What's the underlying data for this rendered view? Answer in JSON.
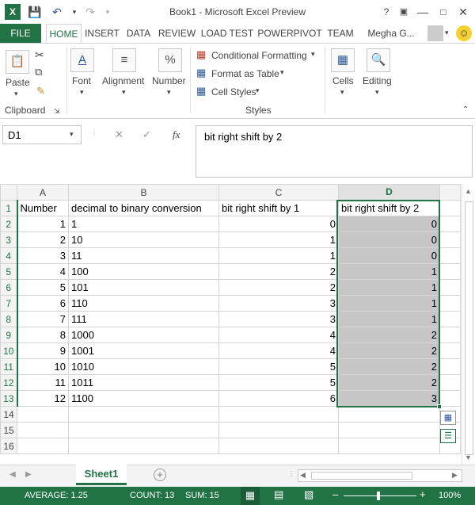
{
  "window": {
    "title": "Book1 - Microsoft Excel Preview"
  },
  "tabs": [
    "FILE",
    "HOME",
    "INSERT",
    "DATA",
    "REVIEW",
    "LOAD TEST",
    "POWERPIVOT",
    "TEAM"
  ],
  "user": "Megha G...",
  "ribbon": {
    "paste": "Paste",
    "clipboard": "Clipboard",
    "font": "Font",
    "alignment": "Alignment",
    "number": "Number",
    "conditional_formatting": "Conditional Formatting",
    "format_as_table": "Format as Table",
    "cell_styles": "Cell Styles",
    "styles": "Styles",
    "cells": "Cells",
    "editing": "Editing"
  },
  "formula_bar": {
    "name_box": "D1",
    "fx": "fx",
    "content": "bit right shift by 2"
  },
  "columns": [
    "A",
    "B",
    "C",
    "D"
  ],
  "rows": [
    [
      "Number",
      "decimal to binary conversion",
      "bit right shift by 1",
      "bit right shift by 2"
    ],
    [
      "1",
      "1",
      "0",
      "0"
    ],
    [
      "2",
      "10",
      "1",
      "0"
    ],
    [
      "3",
      "11",
      "1",
      "0"
    ],
    [
      "4",
      "100",
      "2",
      "1"
    ],
    [
      "5",
      "101",
      "2",
      "1"
    ],
    [
      "6",
      "110",
      "3",
      "1"
    ],
    [
      "7",
      "111",
      "3",
      "1"
    ],
    [
      "8",
      "1000",
      "4",
      "2"
    ],
    [
      "9",
      "1001",
      "4",
      "2"
    ],
    [
      "10",
      "1010",
      "5",
      "2"
    ],
    [
      "11",
      "1011",
      "5",
      "2"
    ],
    [
      "12",
      "1100",
      "6",
      "3"
    ]
  ],
  "row_numbers": [
    "1",
    "2",
    "3",
    "4",
    "5",
    "6",
    "7",
    "8",
    "9",
    "10",
    "11",
    "12",
    "13",
    "14",
    "15",
    "16"
  ],
  "sheet_tab": "Sheet1",
  "status": {
    "average": "AVERAGE: 1.25",
    "count": "COUNT: 13",
    "sum": "SUM: 15",
    "zoom": "100%"
  },
  "colors": {
    "accent": "#217346",
    "selected_fill": "#c6c6c6"
  }
}
